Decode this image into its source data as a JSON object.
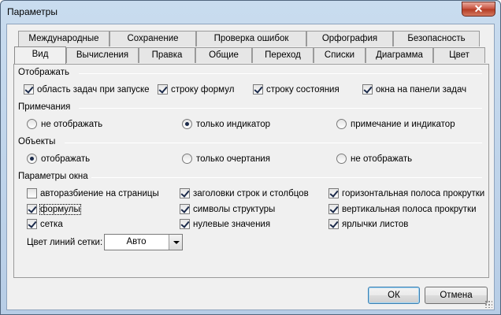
{
  "window": {
    "title": "Параметры",
    "close_label": "✕"
  },
  "tabs_back": [
    "Международные",
    "Сохранение",
    "Проверка ошибок",
    "Орфография",
    "Безопасность"
  ],
  "tabs_front": [
    "Вид",
    "Вычисления",
    "Правка",
    "Общие",
    "Переход",
    "Списки",
    "Диаграмма",
    "Цвет"
  ],
  "active_tab": "Вид",
  "groups": {
    "show": {
      "title": "Отображать",
      "items": [
        {
          "label": "область задач при запуске",
          "checked": true
        },
        {
          "label": "строку формул",
          "checked": true
        },
        {
          "label": "строку состояния",
          "checked": true
        },
        {
          "label": "окна на панели задач",
          "checked": true
        }
      ]
    },
    "comments": {
      "title": "Примечания",
      "items": [
        {
          "label": "не отображать",
          "checked": false
        },
        {
          "label": "только индикатор",
          "checked": true
        },
        {
          "label": "примечание и индикатор",
          "checked": false
        }
      ]
    },
    "objects": {
      "title": "Объекты",
      "items": [
        {
          "label": "отображать",
          "checked": true
        },
        {
          "label": "только очертания",
          "checked": false
        },
        {
          "label": "не отображать",
          "checked": false
        }
      ]
    },
    "window_params": {
      "title": "Параметры окна",
      "items": [
        {
          "label": "авторазбиение на страницы",
          "checked": false
        },
        {
          "label": "заголовки строк и столбцов",
          "checked": true
        },
        {
          "label": "горизонтальная полоса прокрутки",
          "checked": true
        },
        {
          "label": "формулы",
          "checked": true
        },
        {
          "label": "символы структуры",
          "checked": true
        },
        {
          "label": "вертикальная полоса прокрутки",
          "checked": true
        },
        {
          "label": "сетка",
          "checked": true
        },
        {
          "label": "нулевые значения",
          "checked": true
        },
        {
          "label": "ярлычки листов",
          "checked": true
        }
      ],
      "grid_color_label": "Цвет линий сетки:",
      "grid_color_value": "Авто"
    }
  },
  "buttons": {
    "ok": "ОК",
    "cancel": "Отмена"
  }
}
